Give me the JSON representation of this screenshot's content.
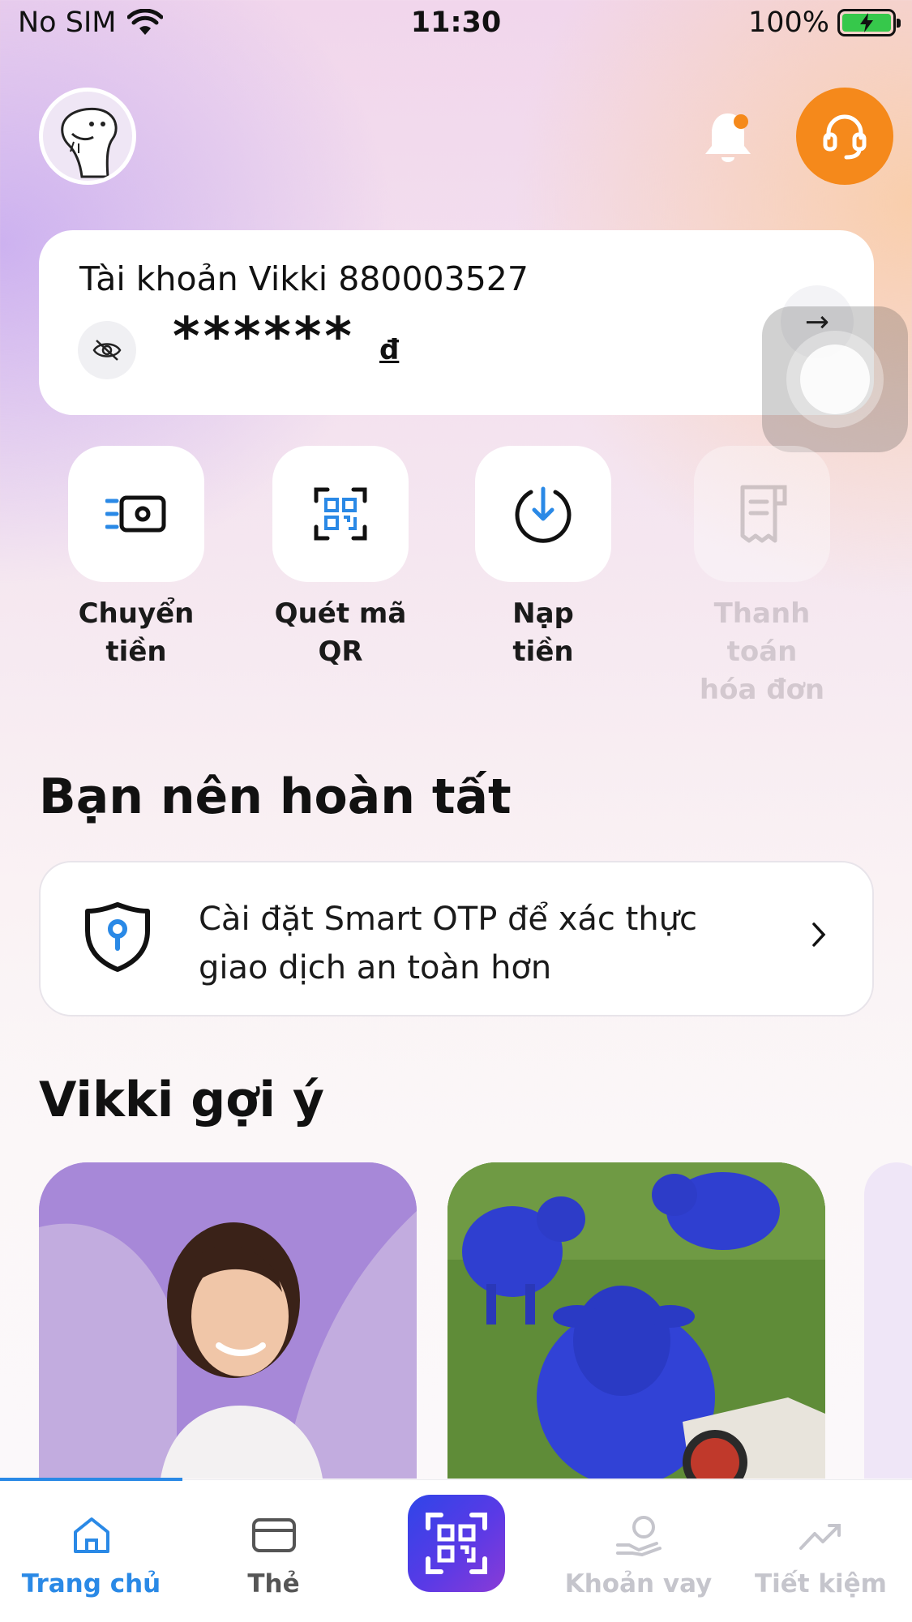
{
  "status_bar": {
    "carrier": "No SIM",
    "time": "11:30",
    "battery_percent": "100%"
  },
  "account": {
    "title": "Tài khoản Vikki 880003527",
    "balance_masked": "******",
    "currency": "đ"
  },
  "quick_actions": [
    {
      "line1": "Chuyển",
      "line2": "tiền",
      "icon": "transfer-icon",
      "enabled": true
    },
    {
      "line1": "Quét mã",
      "line2": "QR",
      "icon": "qr-scan-icon",
      "enabled": true
    },
    {
      "line1": "Nạp",
      "line2": "tiền",
      "icon": "deposit-icon",
      "enabled": true
    },
    {
      "line1": "Thanh toán",
      "line2": "hóa đơn",
      "icon": "bill-icon",
      "enabled": false
    }
  ],
  "complete_section": {
    "title": "Bạn nên hoàn tất",
    "otp_line1": "Cài đặt Smart OTP để xác thực",
    "otp_line2": "giao dịch an toàn hơn"
  },
  "suggest_section": {
    "title": "Vikki gợi ý"
  },
  "bottom_nav": {
    "active": "home",
    "items": [
      {
        "label": "Trang chủ",
        "icon": "home-icon"
      },
      {
        "label": "Thẻ",
        "icon": "card-icon"
      },
      {
        "label": "",
        "icon": "qr-scan-icon"
      },
      {
        "label": "Khoản vay",
        "icon": "loan-icon"
      },
      {
        "label": "Tiết kiệm",
        "icon": "savings-icon"
      }
    ]
  },
  "colors": {
    "accent_blue": "#2a89e6",
    "support_orange": "#f5891b",
    "scan_gradient_start": "#2f45e8",
    "scan_gradient_end": "#8a3bd6",
    "suggest_purple": "#a788d8"
  }
}
